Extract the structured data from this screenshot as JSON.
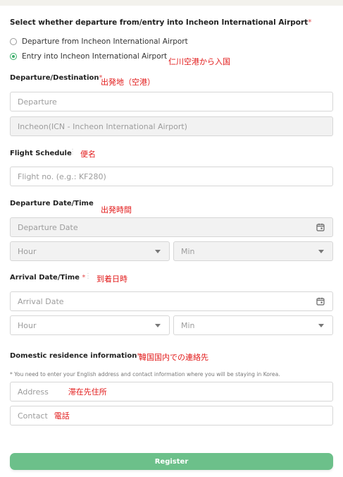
{
  "trip": {
    "question": "Select whether departure from/entry into Incheon International Airport",
    "required_mark": "*",
    "options": [
      {
        "label": "Departure from Incheon International Airport",
        "selected": false
      },
      {
        "label": "Entry into Incheon International Airport",
        "selected": true
      }
    ],
    "note": "仁川空港から入国"
  },
  "departure_destination": {
    "label": "Departure/Destination",
    "required_mark": "*",
    "note": "出発地（空港）",
    "departure_placeholder": "Departure",
    "destination_value": "Incheon(ICN - Incheon International Airport)"
  },
  "flight_schedule": {
    "label": "Flight Schedule",
    "note": "便名",
    "placeholder": "Flight no. (e.g.: KF280)"
  },
  "departure_datetime": {
    "label": "Departure Date/Time",
    "note": "出発時間",
    "date_placeholder": "Departure Date",
    "hour_placeholder": "Hour",
    "min_placeholder": "Min"
  },
  "arrival_datetime": {
    "label": "Arrival Date/Time",
    "required_mark": "*",
    "note": "到着日時",
    "date_placeholder": "Arrival Date",
    "hour_placeholder": "Hour",
    "min_placeholder": "Min"
  },
  "residence": {
    "label": "Domestic residence information",
    "required_mark": "*",
    "note": "韓国国内での連絡先",
    "hint": "* You need to enter your English address and contact information where you will be staying in Korea.",
    "address_placeholder": "Address",
    "address_note": "滞在先住所",
    "contact_placeholder": "Contact",
    "contact_note": "電話"
  },
  "register_label": "Register",
  "colors": {
    "accent": "#6cc08a",
    "required": "#e34b4b",
    "note": "#e21b1b"
  },
  "icons": [
    "radio-icon",
    "calendar-icon",
    "chevron-down-icon"
  ]
}
